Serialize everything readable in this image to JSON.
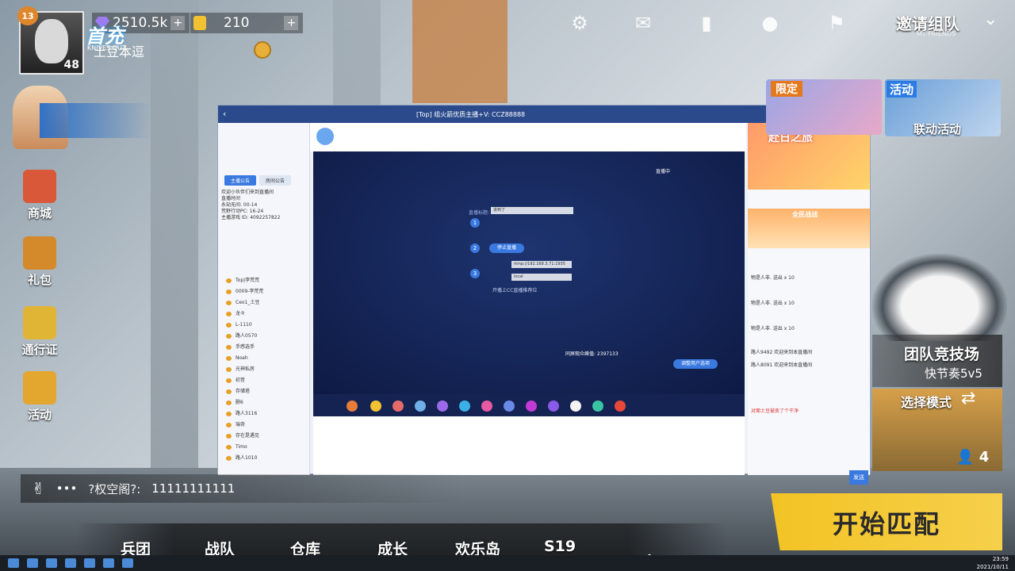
{
  "profile": {
    "level": "13",
    "avatar_level": "48",
    "gems": "2510.5k",
    "coins": "210",
    "username": "土豆本逗"
  },
  "header": {
    "invite_label": "邀请组队",
    "invite_sub": "MY FRIENDS",
    "icons": [
      "gear-icon",
      "mail-icon",
      "stats-icon",
      "person-icon",
      "flag-icon"
    ]
  },
  "left_menu": {
    "first_charge": {
      "title": "首充",
      "sub": "KNIVES OUT"
    },
    "items": [
      {
        "id": "shop",
        "label": "商城",
        "color": "#d9583a"
      },
      {
        "id": "gift",
        "label": "礼包",
        "color": "#d48a2a"
      },
      {
        "id": "pass",
        "label": "通行证",
        "color": "#e0b536"
      },
      {
        "id": "event",
        "label": "活动",
        "color": "#e3a62e"
      }
    ]
  },
  "chat": {
    "name": "?权空阁?:",
    "message": "11111111111"
  },
  "bottom_nav": {
    "items": [
      "兵团",
      "战队",
      "仓库",
      "成长",
      "欢乐岛",
      "S19"
    ]
  },
  "right_panels": {
    "limited_tag": "限定",
    "event_tag": "活动",
    "event_label": "联动活动",
    "team_mode_title": "团队竞技场",
    "team_mode_sub": "快节奏5v5",
    "select_mode": "选择模式",
    "party_count": "4",
    "start_button": "开始匹配"
  },
  "live_window": {
    "title": "[Top] 组火箭优质主播+V: CCZ88888",
    "sidebar": {
      "tabs": [
        "主播公告",
        "房间公告"
      ],
      "info": [
        "欢迎小伙伴们来到直播间",
        "直播时间",
        "永劫无间: 00-14",
        "荒野行动PC: 16-24",
        "主播游戏 ID: 4092257822"
      ],
      "users": [
        "Top|李荒荒",
        "0009-李荒荒",
        "Ceo1_土豆",
        "龙々",
        "L-1110",
        "路人0570",
        "手感选手",
        "Noah",
        "光神私房",
        "初音",
        "存储塔",
        "删6",
        "路人3116",
        "瑞奇",
        "存在是遇见",
        "Timo",
        "路人1010"
      ]
    },
    "stage": {
      "live_label": "直播中",
      "step1_label": "直播标题:",
      "step1_value": "进到了",
      "step2_button": "停止直播",
      "step3_label1": "rtmp://192.168.3.71:1935",
      "step3_label2": "local",
      "checkbox_label": "开播上CC直播推荐位",
      "viewers": "同屏观众峰值: 2397133",
      "action_button": "调整用户选项"
    },
    "right": {
      "promo_title": "赴日之旅",
      "rank_title": "全民战战",
      "chat_lines": [
        "物是人非. 送出 x 10",
        "物是人非. 送出 x 10",
        "物是人非. 送出 x 10",
        "路人9492 欢迎来到本直播间",
        "路人8091 欢迎来到本直播间",
        "对面土豆被卖了个干净"
      ],
      "send_label": "发送"
    }
  },
  "taskbar": {
    "time": "23:59",
    "date": "2021/10/11"
  }
}
